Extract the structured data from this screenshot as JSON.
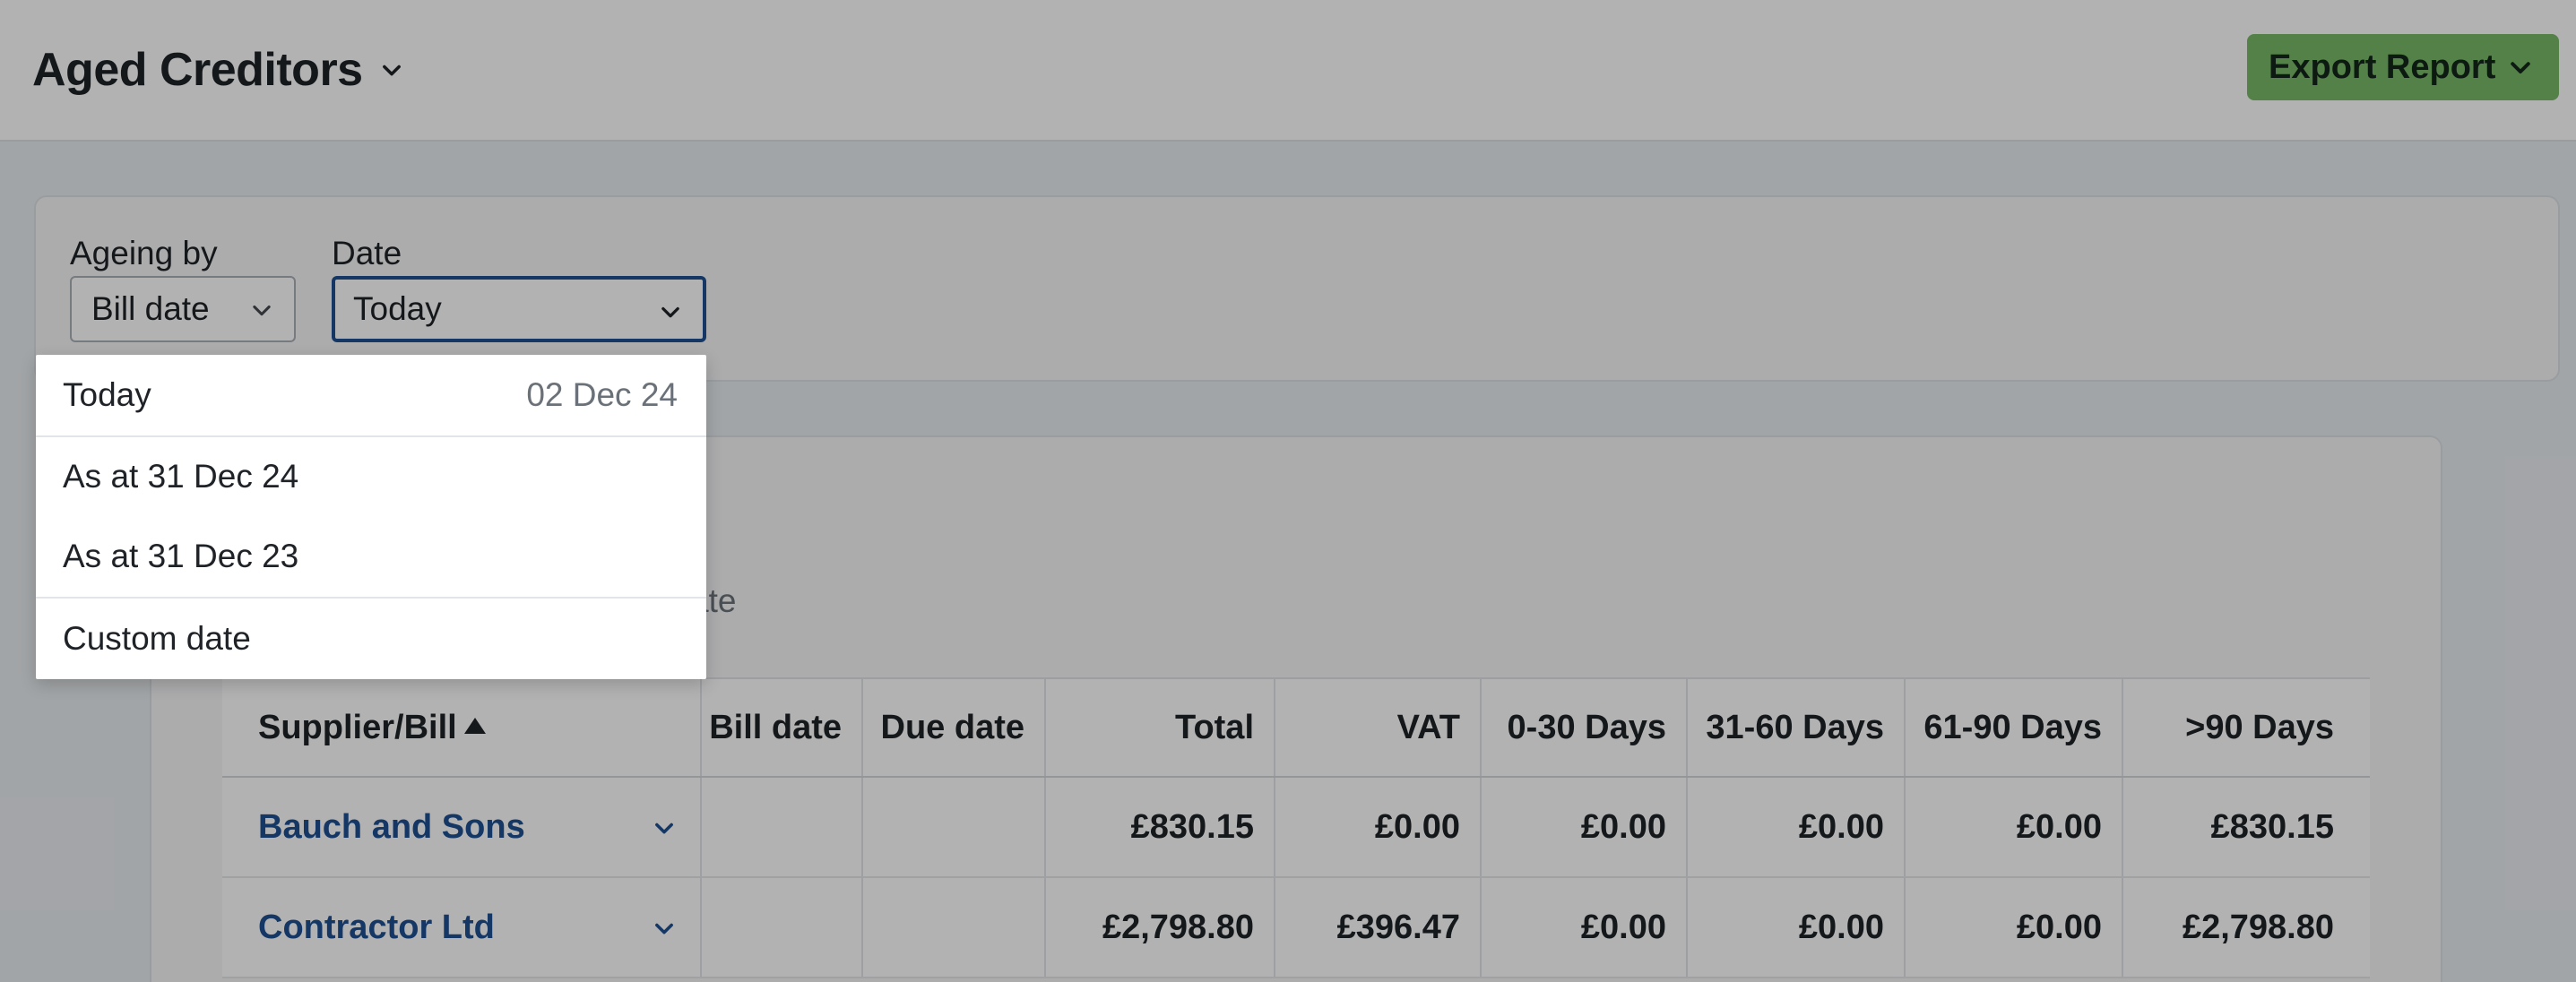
{
  "header": {
    "title": "Aged Creditors",
    "export_label": "Export Report"
  },
  "filters": {
    "ageing_label": "Ageing by",
    "ageing_value": "Bill date",
    "date_label": "Date",
    "date_value": "Today"
  },
  "date_menu": {
    "options": [
      {
        "label": "Today",
        "hint": "02 Dec 24"
      },
      {
        "label": "As at 31 Dec 24",
        "hint": ""
      },
      {
        "label": "As at 31 Dec 23",
        "hint": ""
      },
      {
        "label": "Custom date",
        "hint": ""
      }
    ]
  },
  "report": {
    "subtitle_fragment": "ate",
    "columns": [
      "Supplier/Bill",
      "Bill date",
      "Due date",
      "Total",
      "VAT",
      "0-30 Days",
      "31-60 Days",
      "61-90 Days",
      ">90 Days"
    ],
    "sort": {
      "column": "Supplier/Bill",
      "direction": "ascending"
    },
    "rows": [
      {
        "supplier": "Bauch and Sons",
        "bill_date": "",
        "due_date": "",
        "total": "£830.15",
        "vat": "£0.00",
        "d0_30": "£0.00",
        "d31_60": "£0.00",
        "d61_90": "£0.00",
        "d90_plus": "£830.15"
      },
      {
        "supplier": "Contractor Ltd",
        "bill_date": "",
        "due_date": "",
        "total": "£2,798.80",
        "vat": "£396.47",
        "d0_30": "£0.00",
        "d31_60": "£0.00",
        "d61_90": "£0.00",
        "d90_plus": "£2,798.80"
      }
    ]
  },
  "colors": {
    "accent_blue": "#1d4f91",
    "export_green": "#77b967",
    "overlay": "rgba(0,0,0,0.3)"
  }
}
